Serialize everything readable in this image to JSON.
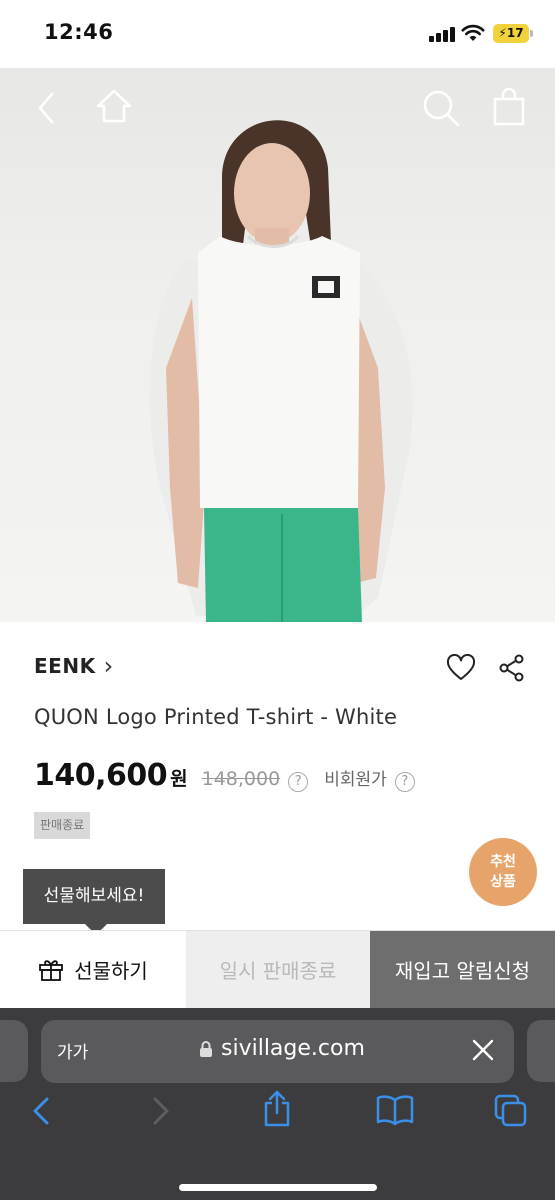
{
  "status_bar": {
    "time": "12:46",
    "battery": "17"
  },
  "hero": {
    "icons": [
      "back-icon",
      "home-icon",
      "search-icon",
      "shopping-bag-icon"
    ]
  },
  "product": {
    "brand": "EENK",
    "brand_chevron": "›",
    "title": "QUON Logo Printed T-shirt - White",
    "price": "140,600",
    "currency": "원",
    "original_price": "148,000",
    "price_note": "비회원가",
    "help_glyph": "?",
    "status_badge": "판매종료"
  },
  "recommend": {
    "line1": "추천",
    "line2": "상품"
  },
  "gift_tooltip": "선물해보세요!",
  "actions": {
    "gift": "선물하기",
    "soldout": "일시 판매종료",
    "restock": "재입고 알림신청"
  },
  "browser": {
    "text_size": "가가",
    "url": "sivillage.com"
  },
  "colors": {
    "recommend_bg": "#e6a46a",
    "restock_bg": "#6e6e6e",
    "tooltip_bg": "#4c4c4c",
    "safari_bg": "#3c3c3e",
    "link_blue": "#3a8fe8"
  }
}
